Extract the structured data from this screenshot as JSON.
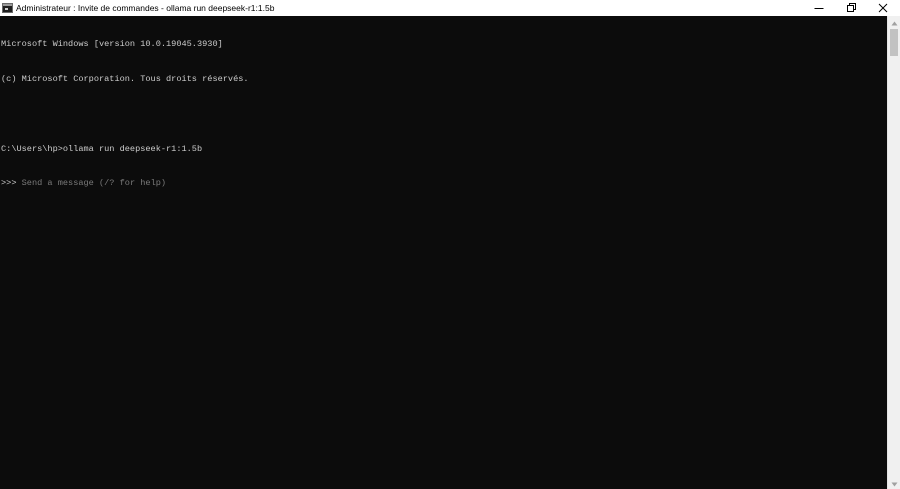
{
  "window": {
    "title": "Administrateur : Invite de commandes - ollama  run deepseek-r1:1.5b",
    "icons": {
      "app": "console-app-icon",
      "minimize": "minimize-icon",
      "maximize": "restore-icon",
      "close": "close-icon"
    }
  },
  "console": {
    "lines": [
      "Microsoft Windows [version 10.0.19045.3930]",
      "(c) Microsoft Corporation. Tous droits réservés.",
      "",
      "C:\\Users\\hp>ollama run deepseek-r1:1.5b"
    ],
    "prompt": ">>> ",
    "placeholder": "Send a message (/? for help)"
  },
  "colors": {
    "background": "#0c0c0c",
    "text": "#cccccc",
    "placeholder": "#7a7a7a",
    "titlebar": "#ffffff"
  }
}
